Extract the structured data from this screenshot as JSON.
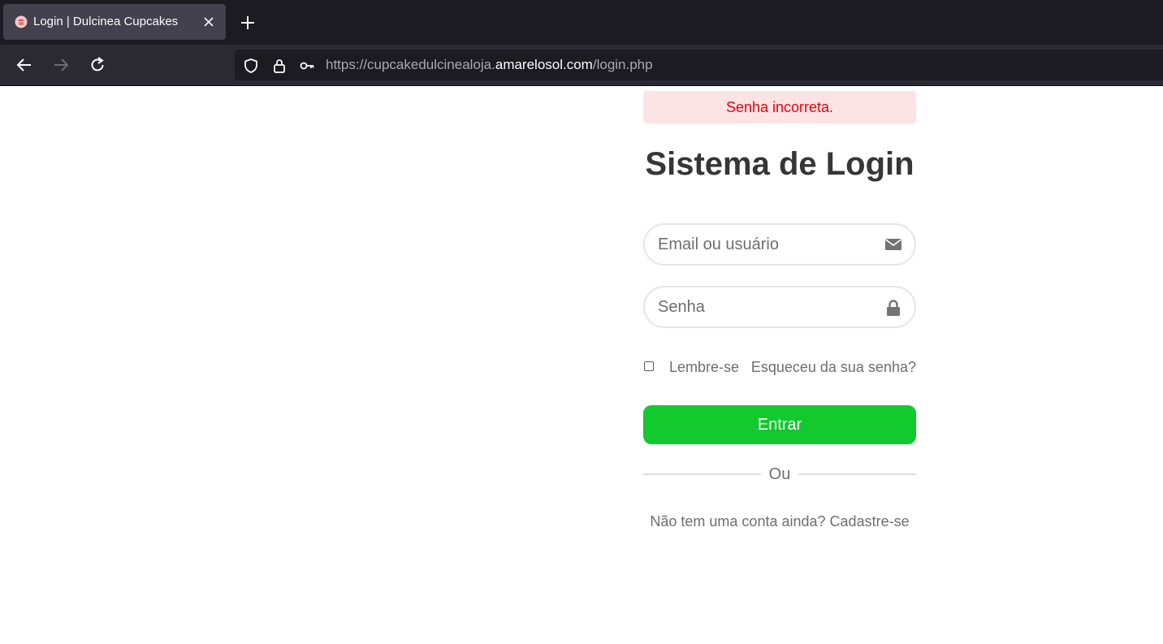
{
  "browser": {
    "tab": {
      "title": "Login | Dulcinea Cupcakes",
      "favicon": "cupcake-icon",
      "close_icon": "close-icon"
    },
    "new_tab_icon": "plus-icon",
    "nav": {
      "back_icon": "arrow-left-icon",
      "forward_icon": "arrow-right-icon",
      "reload_icon": "reload-icon"
    },
    "url": {
      "prefix": "https://cupcakedulcinealoja.",
      "domain": "amarelosol.com",
      "suffix": "/login.php"
    },
    "url_icons": [
      "shield-icon",
      "lock-icon",
      "key-icon"
    ]
  },
  "page": {
    "alert": {
      "text": "Senha incorreta.",
      "bg_color": "#fde4e4",
      "text_color": "#e6000b"
    },
    "title": "Sistema de Login",
    "form": {
      "email_placeholder": "Email ou usuário",
      "email_value": "",
      "email_icon": "envelope-icon",
      "password_placeholder": "Senha",
      "password_value": "",
      "password_icon": "lock-icon",
      "remember_label": "Lembre-se",
      "remember_checked": false,
      "forgot_label": "Esqueceu da sua senha?",
      "submit_label": "Entrar",
      "submit_color": "#12c92e"
    },
    "divider_text": "Ou",
    "signup": {
      "prompt": "Não tem uma conta ainda?",
      "link_label": "Cadastre-se"
    }
  }
}
